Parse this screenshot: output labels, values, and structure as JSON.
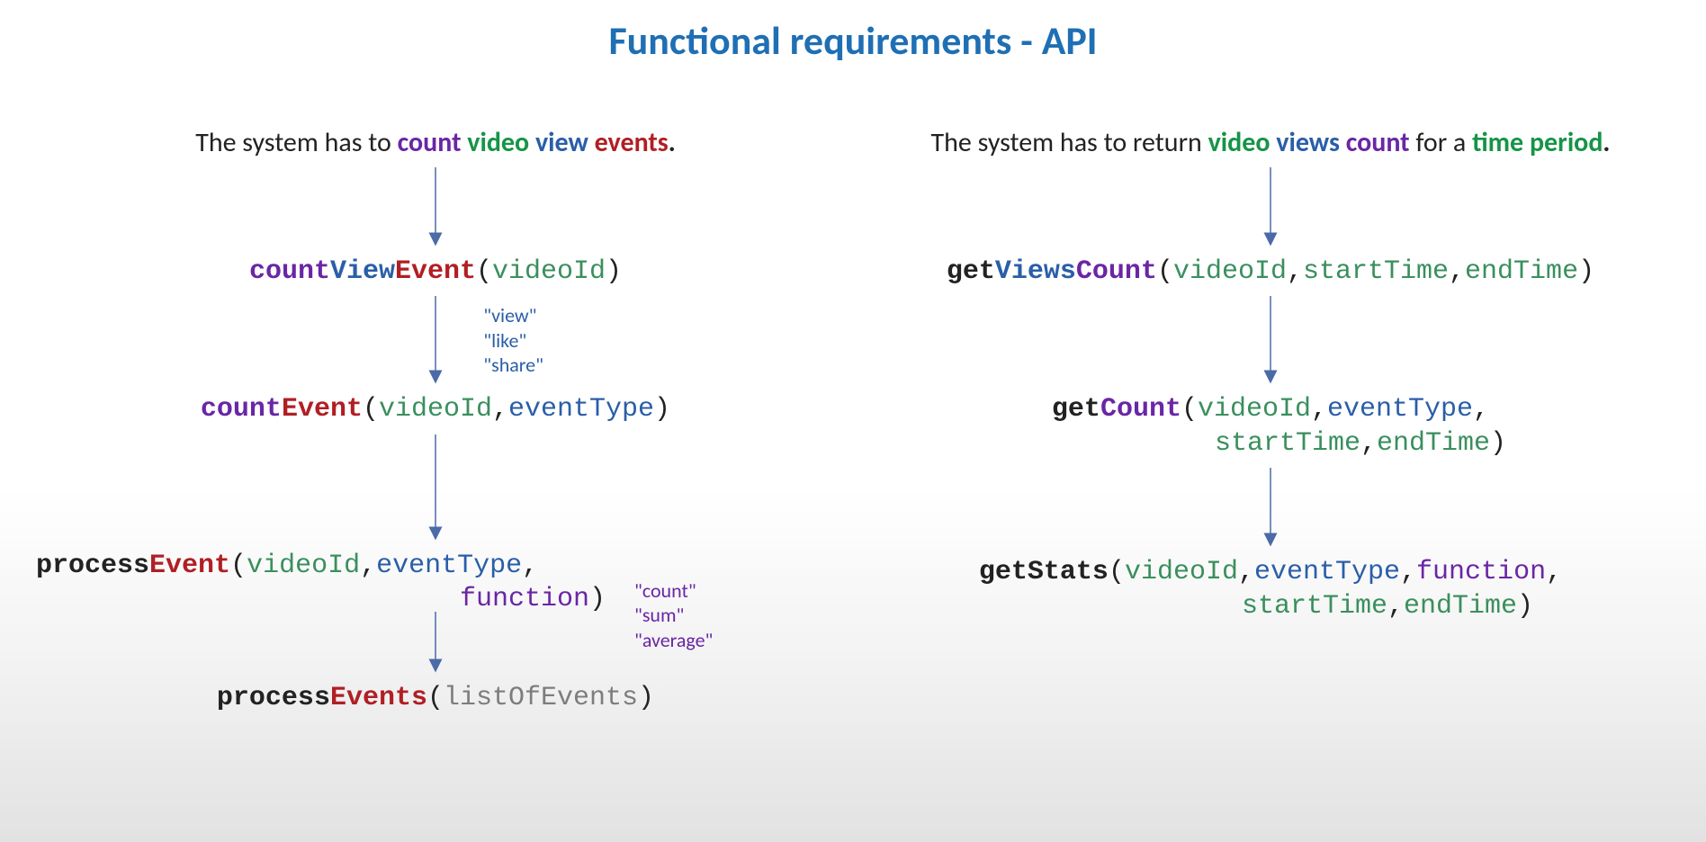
{
  "title": "Functional requirements - API",
  "left": {
    "req_prefix": "The system has to ",
    "req_w1": "count ",
    "req_w2": "video ",
    "req_w3": "view ",
    "req_w4": "events",
    "sig1_p1": "count",
    "sig1_p2": "View",
    "sig1_p3": "Event",
    "paren_open": "(",
    "paren_close": ")",
    "sig1_a1": "videoId",
    "annot_events": "\"view\"\n\"like\"\n\"share\"",
    "sig2_p1": "count",
    "sig2_p2": "Event",
    "sig2_a1": "videoId",
    "comma": ",",
    "sig2_a2": "eventType",
    "sig3_p1": "process",
    "sig3_p2": "Event",
    "sig3_a1": "videoId",
    "sig3_a2": "eventType",
    "sig3_line2_a3": "function",
    "annot_funcs": "\"count\"\n\"sum\"\n\"average\"",
    "sig4_p1": "process",
    "sig4_p2": "Events",
    "sig4_a1": "listOfEvents"
  },
  "right": {
    "req_prefix": "The system has to return ",
    "req_w1": "video ",
    "req_w2": "views ",
    "req_w3": "count",
    "req_mid": " for a ",
    "req_w4": "time ",
    "req_w5": "period",
    "sig1_p1": "get",
    "sig1_p2": "Views",
    "sig1_p3": "Count",
    "sig1_a1": "videoId",
    "sig1_a2": "startTime",
    "sig1_a3": "endTime",
    "sig2_p1": "get",
    "sig2_p2": "Count",
    "sig2_a1": "videoId",
    "sig2_a2": "eventType",
    "sig2_line2_a3": "startTime",
    "sig2_line2_a4": "endTime",
    "sig3_p1": "get",
    "sig3_p2": "Stats",
    "sig3_a1": "videoId",
    "sig3_a2": "eventType",
    "sig3_a3": "function",
    "sig3_line2_a4": "startTime",
    "sig3_line2_a5": "endTime"
  },
  "period": "."
}
